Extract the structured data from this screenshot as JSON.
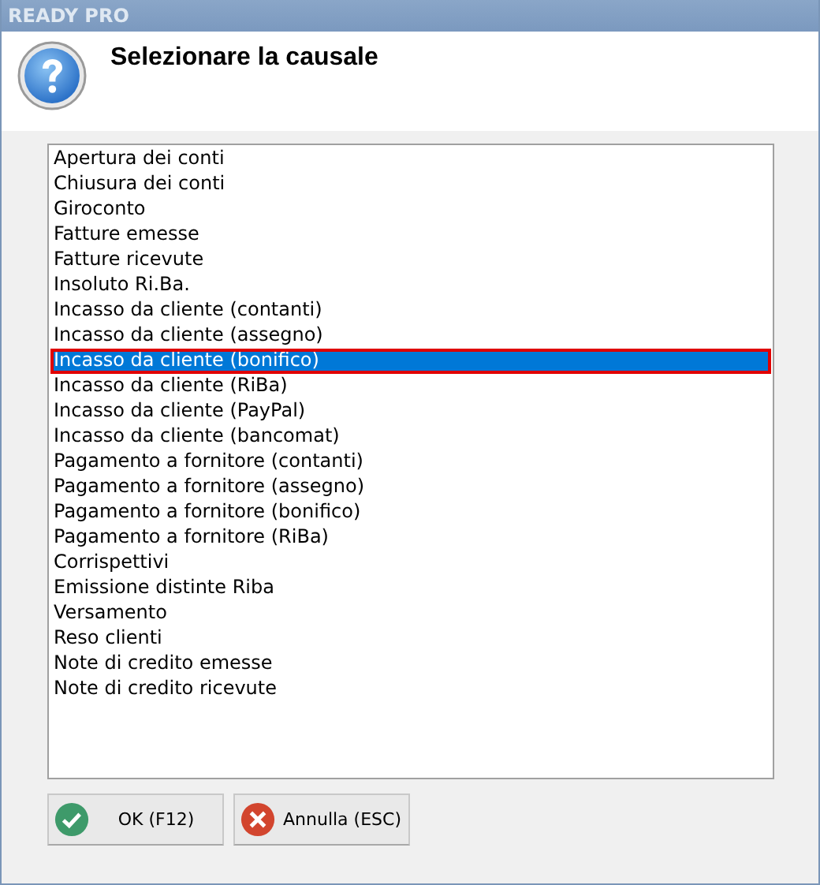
{
  "window": {
    "title": "READY PRO"
  },
  "header": {
    "title": "Selezionare la causale"
  },
  "list": {
    "items": [
      {
        "label": "Apertura dei conti",
        "selected": false
      },
      {
        "label": "Chiusura dei conti",
        "selected": false
      },
      {
        "label": "Giroconto",
        "selected": false
      },
      {
        "label": "Fatture emesse",
        "selected": false
      },
      {
        "label": "Fatture ricevute",
        "selected": false
      },
      {
        "label": "Insoluto Ri.Ba.",
        "selected": false
      },
      {
        "label": "Incasso da cliente (contanti)",
        "selected": false
      },
      {
        "label": "Incasso da cliente (assegno)",
        "selected": false
      },
      {
        "label": "Incasso da cliente (bonifico)",
        "selected": true
      },
      {
        "label": "Incasso da cliente (RiBa)",
        "selected": false
      },
      {
        "label": "Incasso da cliente (PayPal)",
        "selected": false
      },
      {
        "label": "Incasso da cliente (bancomat)",
        "selected": false
      },
      {
        "label": "Pagamento a fornitore (contanti)",
        "selected": false
      },
      {
        "label": "Pagamento a fornitore (assegno)",
        "selected": false
      },
      {
        "label": "Pagamento a fornitore (bonifico)",
        "selected": false
      },
      {
        "label": "Pagamento a fornitore (RiBa)",
        "selected": false
      },
      {
        "label": "Corrispettivi",
        "selected": false
      },
      {
        "label": "Emissione distinte Riba",
        "selected": false
      },
      {
        "label": "Versamento",
        "selected": false
      },
      {
        "label": "Reso clienti",
        "selected": false
      },
      {
        "label": "Note di credito emesse",
        "selected": false
      },
      {
        "label": "Note di credito ricevute",
        "selected": false
      }
    ]
  },
  "buttons": [
    {
      "kind": "ok",
      "label": "OK (F12)"
    },
    {
      "kind": "cancel",
      "label": "Annulla (ESC)"
    }
  ]
}
